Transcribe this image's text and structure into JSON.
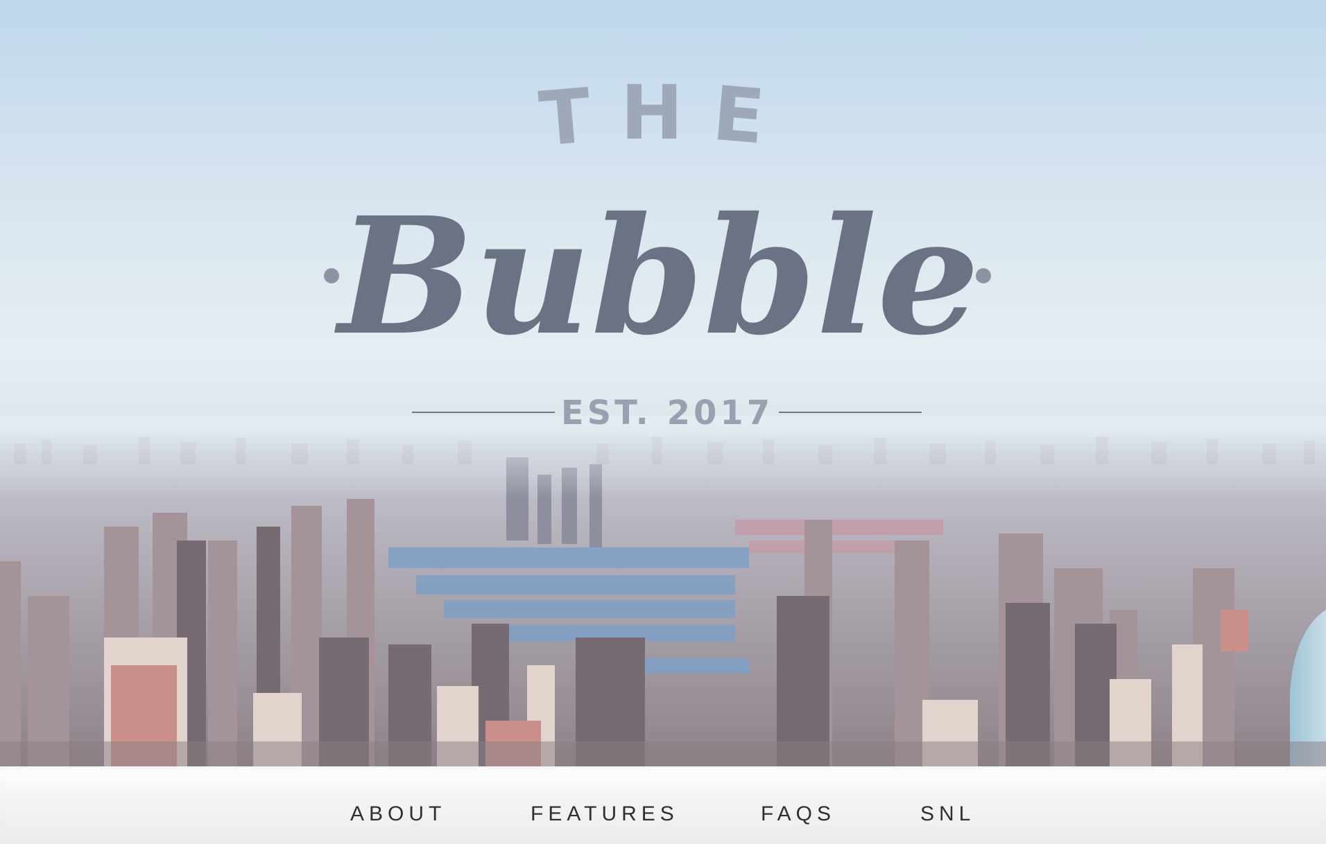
{
  "logo": {
    "top_word": "THE",
    "name": "Bubble",
    "established": "EST. 2017"
  },
  "nav": {
    "items": [
      {
        "label": "ABOUT"
      },
      {
        "label": "FEATURES"
      },
      {
        "label": "FAQS"
      },
      {
        "label": "SNL"
      }
    ]
  },
  "colors": {
    "logo_primary": "#6b7284",
    "logo_secondary": "#9ea8b8",
    "nav_text": "#2f2f33",
    "nav_background": "#f4f4f5"
  },
  "hero": {
    "image": "aerial-city-skyline-photo"
  }
}
